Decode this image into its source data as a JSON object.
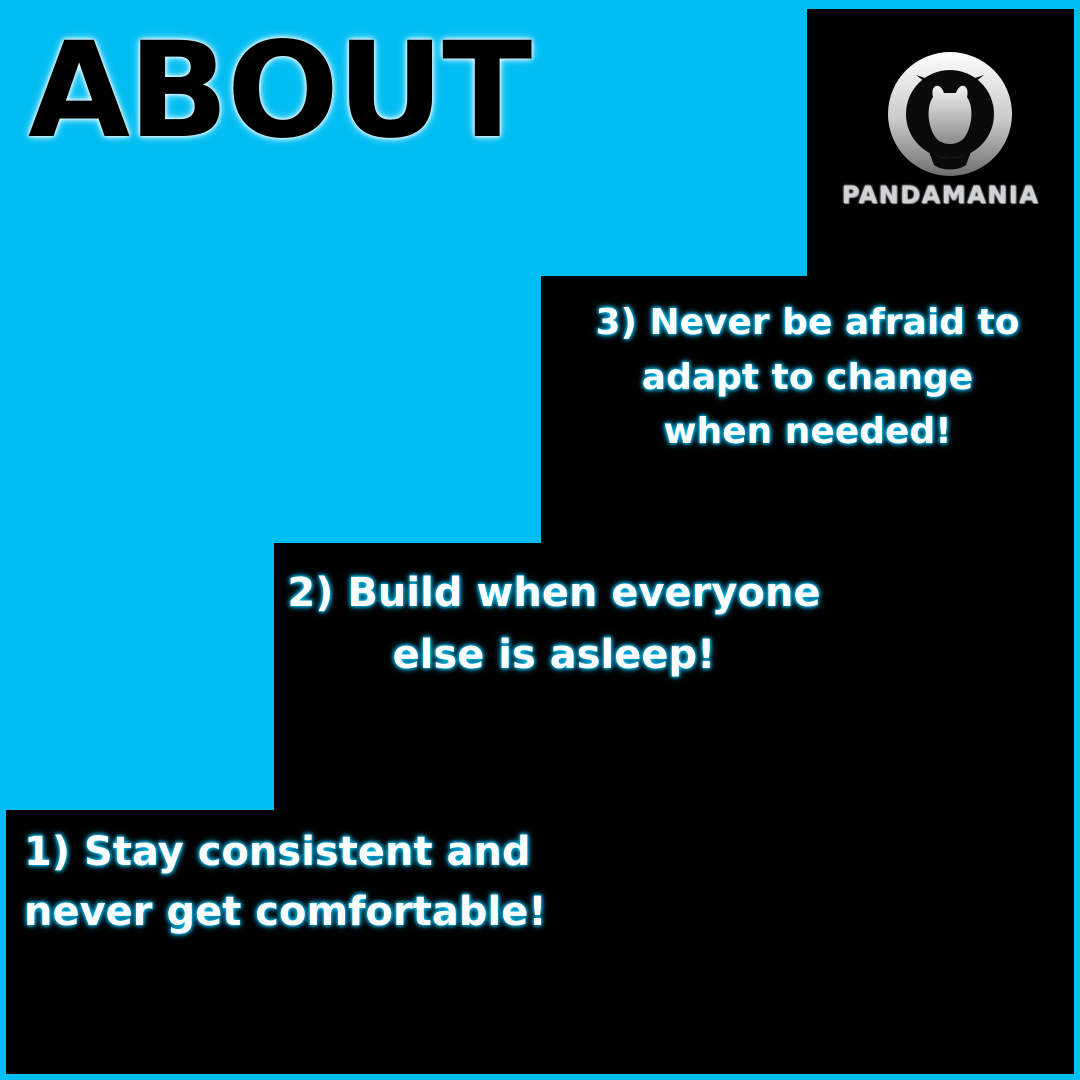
{
  "headline": "ABOUT",
  "brand": {
    "name": "PANDAMANIA",
    "icon": "panda-emblem-icon"
  },
  "steps": [
    {
      "text": "1) Stay consistent and\nnever get comfortable!"
    },
    {
      "text": "2) Build when everyone\nelse is asleep!"
    },
    {
      "text": "3) Never be afraid to\nadapt to change\nwhen needed!"
    }
  ],
  "colors": {
    "background": "#00BDF2",
    "staircase": "#000000",
    "text": "#FFFFFF",
    "glow": "#00BDF2"
  }
}
